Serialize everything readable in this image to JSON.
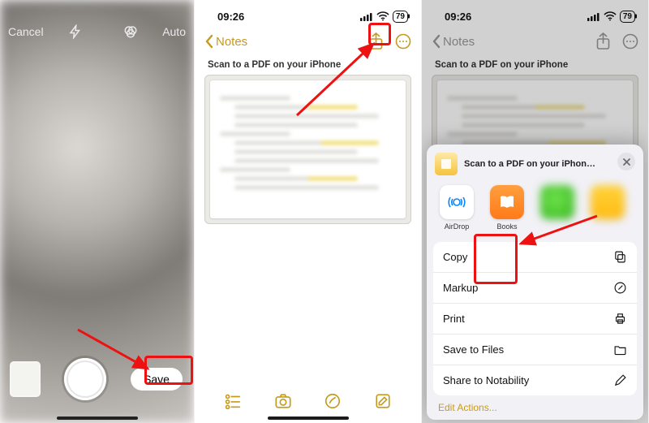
{
  "phone1": {
    "top": {
      "cancel": "Cancel",
      "auto": "Auto"
    },
    "save_label": "Save"
  },
  "phone2": {
    "status": {
      "time": "09:26",
      "battery": "79"
    },
    "nav": {
      "back_label": "Notes"
    },
    "note_title": "Scan to a PDF on your iPhone"
  },
  "phone3": {
    "status": {
      "time": "09:26",
      "battery": "79"
    },
    "nav": {
      "back_label": "Notes"
    },
    "note_title": "Scan to a PDF on your iPhone",
    "sheet": {
      "title": "Scan to a PDF on your iPhon…",
      "apps": {
        "airdrop": "AirDrop",
        "books": "Books"
      },
      "actions": {
        "copy": "Copy",
        "markup": "Markup",
        "print": "Print",
        "save_files": "Save to Files",
        "share_notability": "Share to Notability"
      },
      "edit_actions": "Edit Actions..."
    }
  }
}
